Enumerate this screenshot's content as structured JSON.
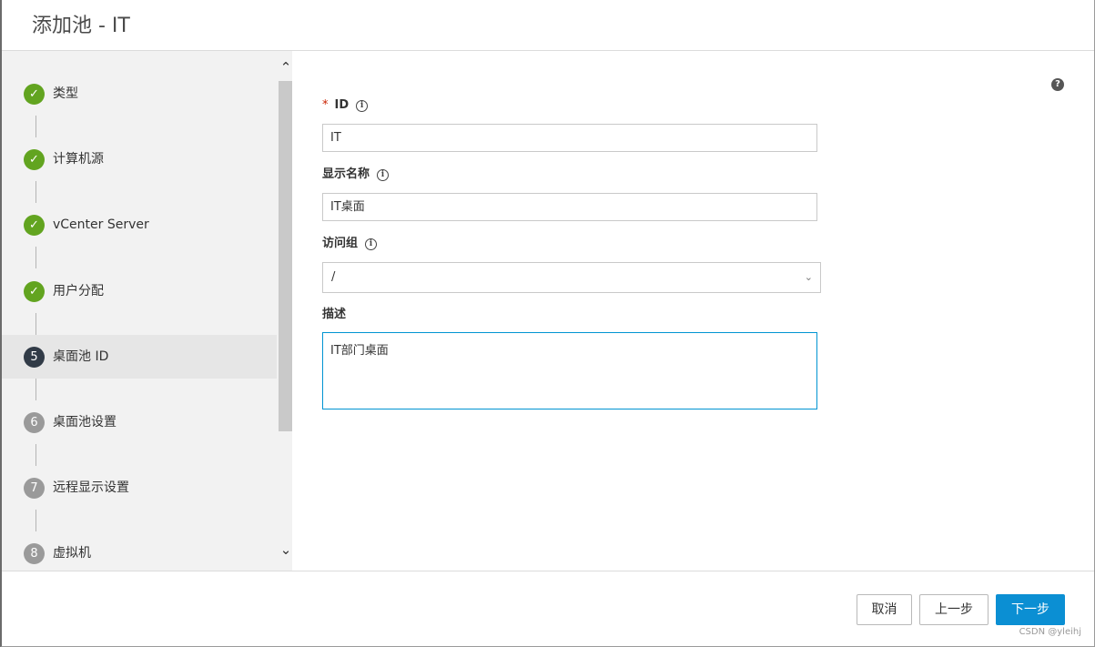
{
  "dialog": {
    "title": "添加池 - IT"
  },
  "steps": [
    {
      "number": "",
      "label": "类型",
      "state": "done"
    },
    {
      "number": "",
      "label": "计算机源",
      "state": "done"
    },
    {
      "number": "",
      "label": "vCenter Server",
      "state": "done"
    },
    {
      "number": "",
      "label": "用户分配",
      "state": "done"
    },
    {
      "number": "5",
      "label": "桌面池 ID",
      "state": "current"
    },
    {
      "number": "6",
      "label": "桌面池设置",
      "state": "todo"
    },
    {
      "number": "7",
      "label": "远程显示设置",
      "state": "todo"
    },
    {
      "number": "8",
      "label": "虚拟机",
      "state": "todo"
    }
  ],
  "form": {
    "help_glyph": "?",
    "id": {
      "required_mark": "*",
      "label": "ID",
      "value": "IT"
    },
    "display_name": {
      "label": "显示名称",
      "value": "IT桌面"
    },
    "access_group": {
      "label": "访问组",
      "value": "/"
    },
    "description": {
      "label": "描述",
      "value": "IT部门桌面"
    }
  },
  "footer": {
    "cancel_label": "取消",
    "back_label": "上一步",
    "next_label": "下一步",
    "watermark": "CSDN @yleihj"
  },
  "colors": {
    "done": "#62a420",
    "current": "#313b47",
    "todo": "#9a9a9a",
    "primary": "#0b8fd3",
    "focus_border": "#0094d2"
  },
  "icons": {
    "check": "check-icon",
    "info": "info-icon",
    "help": "help-icon",
    "dropdown": "chevron-down-icon"
  }
}
